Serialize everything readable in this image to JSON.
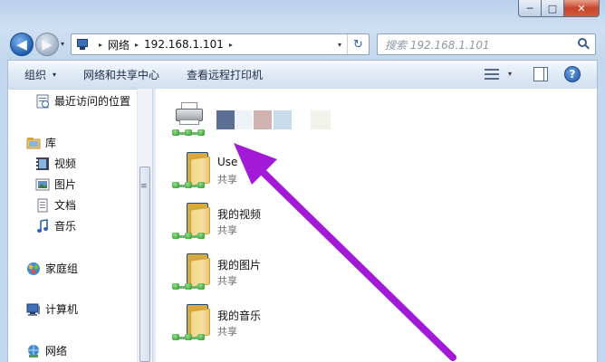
{
  "window": {
    "caption": {
      "minimize": "─",
      "maximize": "□",
      "close": "✕"
    }
  },
  "nav": {
    "back_glyph": "◀",
    "forward_glyph": "▶",
    "dropdown_glyph": "▾"
  },
  "address": {
    "crumb_sep": "▸",
    "crumbs": [
      "网络",
      "192.168.1.101"
    ],
    "dropdown_glyph": "▾",
    "refresh_glyph": "↻"
  },
  "search": {
    "placeholder": "搜索 192.168.1.101"
  },
  "command_bar": {
    "organize": "组织",
    "network_sharing": "网络和共享中心",
    "remote_printer": "查看远程打印机",
    "organize_arrow": "▾",
    "view_dropdown": "▾",
    "help": "?"
  },
  "sidebar": {
    "items": [
      {
        "label": "最近访问的位置",
        "icon": "recent-places-icon"
      },
      {
        "label": "库",
        "icon": "libraries-icon"
      },
      {
        "label": "视频",
        "icon": "videos-icon"
      },
      {
        "label": "图片",
        "icon": "pictures-icon"
      },
      {
        "label": "文档",
        "icon": "documents-icon"
      },
      {
        "label": "音乐",
        "icon": "music-icon"
      },
      {
        "label": "家庭组",
        "icon": "homegroup-icon"
      },
      {
        "label": "计算机",
        "icon": "computer-icon"
      },
      {
        "label": "网络",
        "icon": "network-icon"
      }
    ],
    "scroll_grip": "≡"
  },
  "content": {
    "printer": {
      "icon": "shared-printer-icon",
      "colors": [
        "#5b6f95",
        "#eef3f8",
        "#cfb3b0",
        "#c9dcec",
        "#f1f2ea"
      ]
    },
    "folders": [
      {
        "name": "Use",
        "subtitle": "共享"
      },
      {
        "name": "我的视频",
        "subtitle": "共享"
      },
      {
        "name": "我的图片",
        "subtitle": "共享"
      },
      {
        "name": "我的音乐",
        "subtitle": "共享"
      }
    ]
  },
  "annotation": {
    "arrow_color": "#a21ad6"
  }
}
